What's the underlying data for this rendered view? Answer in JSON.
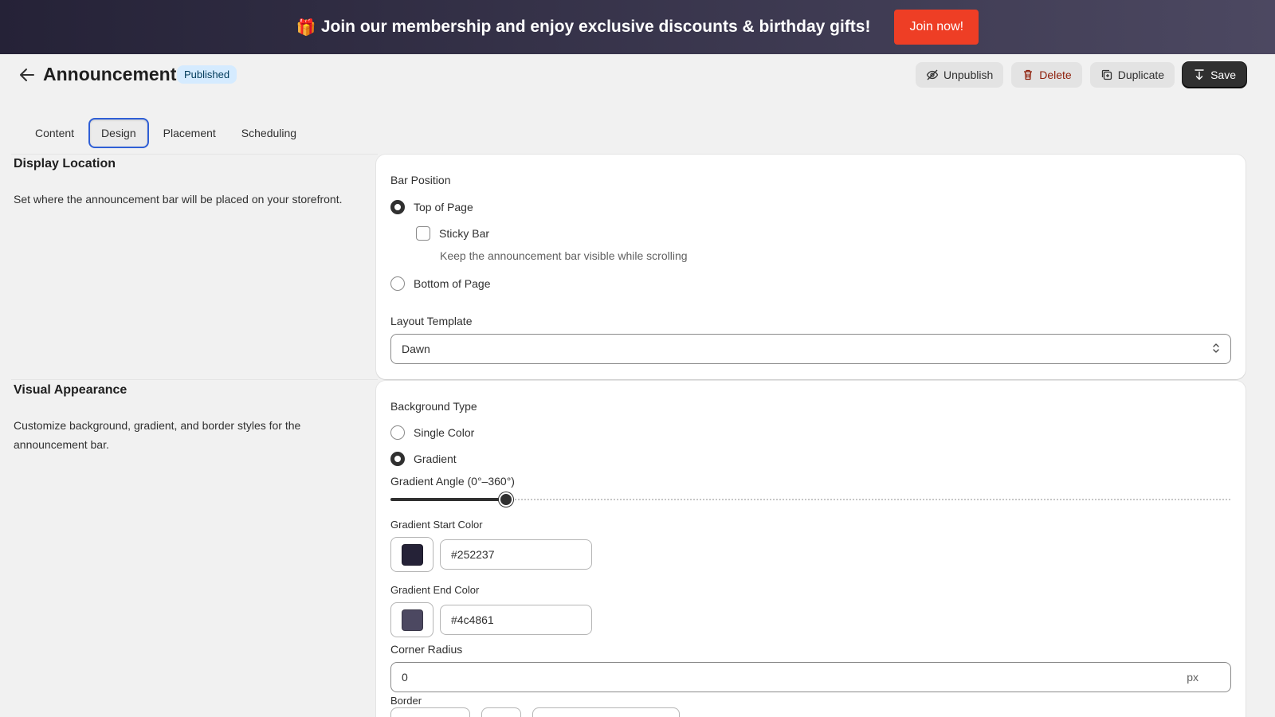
{
  "promo": {
    "icon": "gift-icon",
    "text": "Join our membership and enjoy exclusive discounts & birthday gifts!",
    "button": "Join now!",
    "gradient_start": "#252237",
    "gradient_end": "#4c4861",
    "button_color": "#ee3e25"
  },
  "header": {
    "title": "Announcement",
    "status": "Published",
    "actions": {
      "unpublish": "Unpublish",
      "delete": "Delete",
      "duplicate": "Duplicate",
      "save": "Save"
    }
  },
  "tabs": [
    {
      "label": "Content",
      "active": false
    },
    {
      "label": "Design",
      "active": true
    },
    {
      "label": "Placement",
      "active": false
    },
    {
      "label": "Scheduling",
      "active": false
    }
  ],
  "display_location": {
    "title": "Display Location",
    "description": "Set where the announcement bar will be placed on your storefront.",
    "bar_position_label": "Bar Position",
    "options": {
      "top": {
        "label": "Top of Page",
        "selected": true
      },
      "sticky": {
        "label": "Sticky Bar",
        "checked": false,
        "help": "Keep the announcement bar visible while scrolling"
      },
      "bottom": {
        "label": "Bottom of Page",
        "selected": false
      }
    },
    "layout_label": "Layout Template",
    "layout_value": "Dawn"
  },
  "visual": {
    "title": "Visual Appearance",
    "description": "Customize background, gradient, and border styles for the announcement bar.",
    "background_type_label": "Background Type",
    "options": {
      "single": {
        "label": "Single Color",
        "selected": false
      },
      "gradient": {
        "label": "Gradient",
        "selected": true
      }
    },
    "angle_label": "Gradient Angle (0°–360°)",
    "angle_fraction": 0.137,
    "start_label": "Gradient Start Color",
    "start_value": "#252237",
    "end_label": "Gradient End Color",
    "end_value": "#4c4861",
    "radius_label": "Corner Radius",
    "radius_value": "0",
    "radius_unit": "px",
    "border_label": "Border"
  }
}
